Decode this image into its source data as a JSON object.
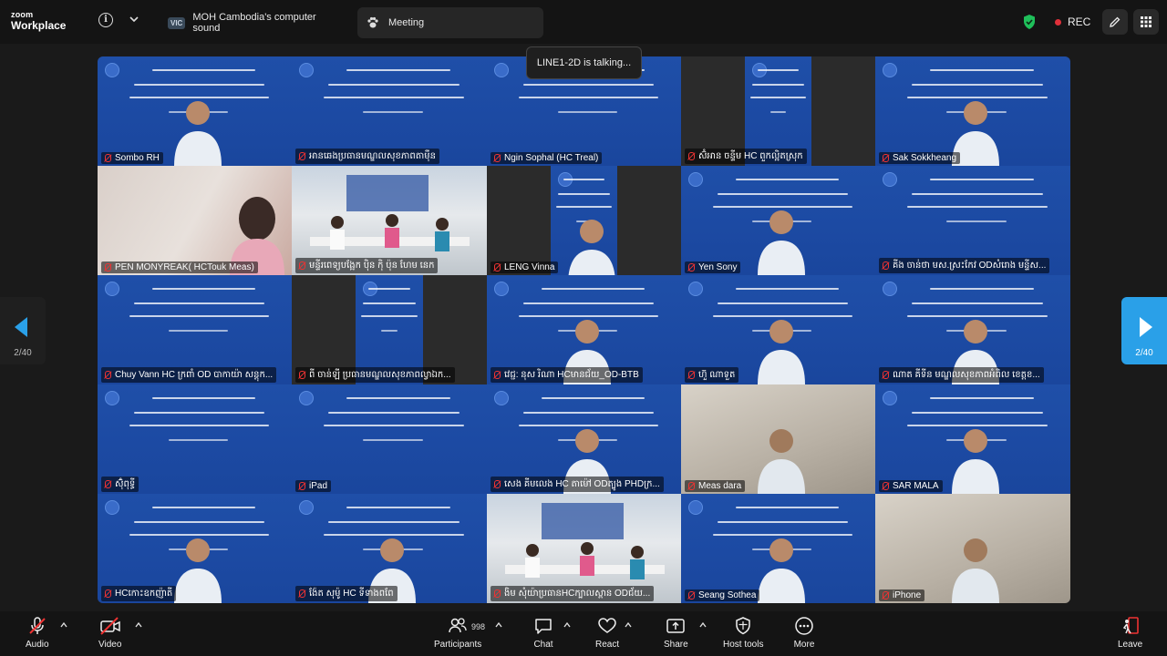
{
  "topbar": {
    "logo_line1": "zoom",
    "logo_line2": "Workplace",
    "tabs": [
      {
        "badge": "VIC",
        "label": "MOH Cambodia's computer sound"
      },
      {
        "label": "Meeting"
      }
    ],
    "rec_label": "REC"
  },
  "toast": {
    "text": "LINE1-2D is talking..."
  },
  "navigation": {
    "page_left": "2/40",
    "page_right": "2/40"
  },
  "participants": [
    {
      "name": "Sombo RH",
      "kind": "slide-person"
    },
    {
      "name": "អានឆេងប្រធានមណ្ឌលសុខភាពតាម៉ឺន",
      "kind": "slide"
    },
    {
      "name": "Ngin Sophal (HC Treal)",
      "kind": "slide"
    },
    {
      "name": "ស៊ំអាន ចន្ទីម HC ពួកល្អិតស្រុក",
      "kind": "slide-narrow"
    },
    {
      "name": "Sak Sokkheang",
      "kind": "slide-person"
    },
    {
      "name": "PEN MONYREAK( HCTouk Meas)",
      "kind": "photo-pink"
    },
    {
      "name": "មន្ទីរពេទ្យបង្អែក ប៉ិន ក៉ិ ប៉ុន ហែម នេក",
      "kind": "photo-room"
    },
    {
      "name": "LENG Vinna",
      "kind": "slide-narrow-person"
    },
    {
      "name": "Yen Sony",
      "kind": "slide-person"
    },
    {
      "name": "គីង ចាន់ថា មស.ស្រះកែវ ODសំរោង មន្ទីស...",
      "kind": "slide"
    },
    {
      "name": "Chuy Vann HC ក្រពាំ OD បាកាយ៉ា សន្តុក...",
      "kind": "slide"
    },
    {
      "name": "ពី ចាន់ឡី ប្រធានមណ្ឌលសុខភាពល្វាឯក...",
      "kind": "slide-narrow"
    },
    {
      "name": "វេជ្ជ: នុស រិណា HCមានជ័យ_OD-BTB",
      "kind": "slide-person"
    },
    {
      "name": "ហ៊ួ ណាទួត",
      "kind": "slide-person"
    },
    {
      "name": "ណាត គីទីន មណ្ឌលសុខភាពអំពិល ខេត្តខ...",
      "kind": "slide-person"
    },
    {
      "name": "ស៊ុំពុទ្ធី",
      "kind": "slide"
    },
    {
      "name": "iPad",
      "kind": "slide"
    },
    {
      "name": "សេង គីមលេង HC តាម៉ៅ ODត្បូង PHDក្រ...",
      "kind": "slide-person"
    },
    {
      "name": "Meas dara",
      "kind": "photo-wall"
    },
    {
      "name": "SAR MALA",
      "kind": "slide-person"
    },
    {
      "name": "HCកោះឧកញ៉ាតី",
      "kind": "slide-person"
    },
    {
      "name": "ង៉ែត សុម៉ូ HC ទីទាងពពែ",
      "kind": "slide-person"
    },
    {
      "name": "ងិម សុំយ៉ាប្រធានHCក្បាលស្ពាន ODជ័យ...",
      "kind": "photo-room"
    },
    {
      "name": "Seang Sothea",
      "kind": "slide-person"
    },
    {
      "name": "iPhone",
      "kind": "photo-wall"
    }
  ],
  "bottombar": {
    "audio": "Audio",
    "video": "Video",
    "participants": "Participants",
    "participants_count": "998",
    "chat": "Chat",
    "react": "React",
    "share": "Share",
    "host_tools": "Host tools",
    "more": "More",
    "leave": "Leave"
  },
  "colors": {
    "slide_blue": "#1f4fa8",
    "accent": "#2aa0e8",
    "rec_red": "#e0303a",
    "shield_green": "#1fbf5a"
  }
}
